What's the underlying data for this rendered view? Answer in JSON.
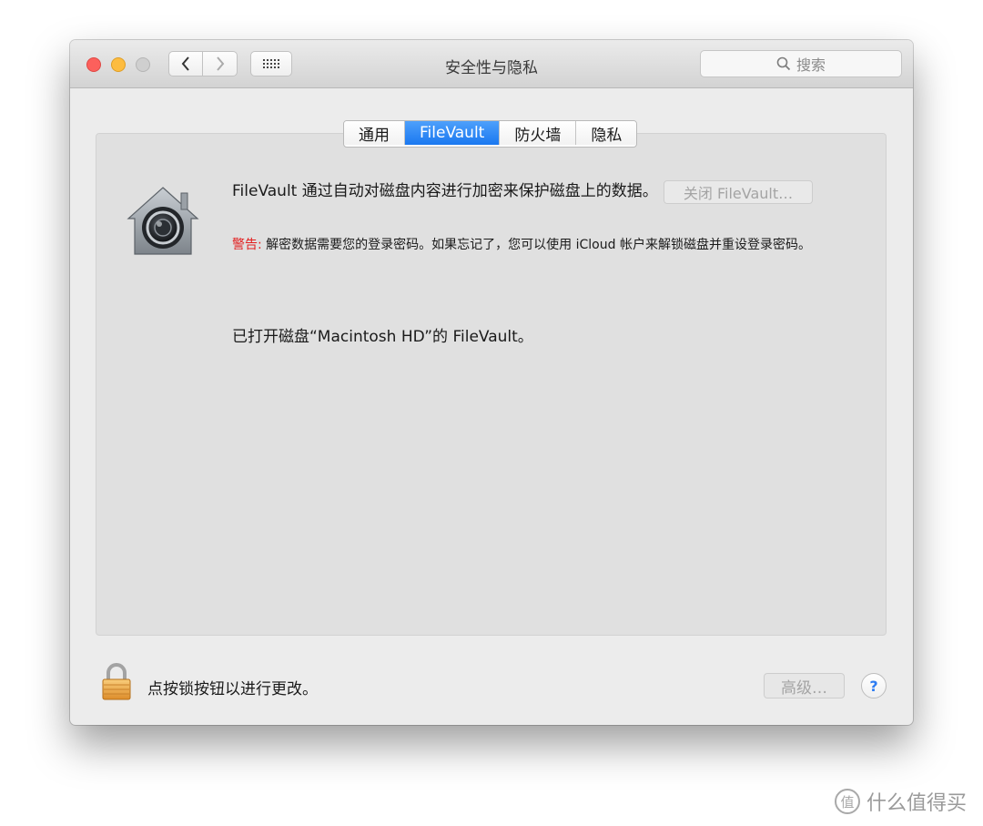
{
  "window": {
    "title": "安全性与隐私"
  },
  "toolbar": {
    "back_icon": "chevron-left-icon",
    "forward_icon": "chevron-right-icon",
    "grid_icon": "grid-icon",
    "search_placeholder": "搜索"
  },
  "tabs": [
    {
      "label": "通用",
      "selected": false
    },
    {
      "label": "FileVault",
      "selected": true
    },
    {
      "label": "防火墙",
      "selected": false
    },
    {
      "label": "隐私",
      "selected": false
    }
  ],
  "filevault": {
    "description": "FileVault 通过自动对磁盘内容进行加密来保护磁盘上的数据。",
    "warning_label": "警告:",
    "warning_text": "解密数据需要您的登录密码。如果忘记了，您可以使用 iCloud 帐户来解锁磁盘并重设登录密码。",
    "status": "已打开磁盘“Macintosh HD”的 FileVault。",
    "turn_off_button": "关闭 FileVault…"
  },
  "footer": {
    "lock_text": "点按锁按钮以进行更改。",
    "advanced_button": "高级…",
    "help_button": "?"
  },
  "watermark": {
    "text": "什么值得买",
    "glyph": "值"
  },
  "colors": {
    "accent": "#1a78f0",
    "warning": "#e21f1f"
  }
}
